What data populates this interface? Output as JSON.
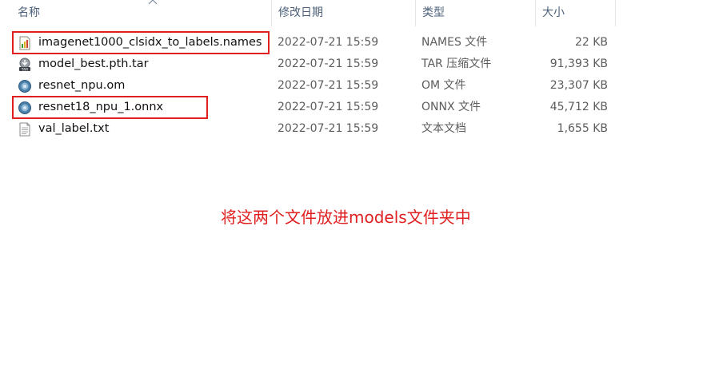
{
  "columns": {
    "name": "名称",
    "date": "修改日期",
    "type": "类型",
    "size": "大小"
  },
  "files": [
    {
      "name": "imagenet1000_clsidx_to_labels.names",
      "date": "2022-07-21 15:59",
      "type": "NAMES 文件",
      "size": "22 KB",
      "icon": "names-file-icon",
      "highlighted": true
    },
    {
      "name": "model_best.pth.tar",
      "date": "2022-07-21 15:59",
      "type": "TAR 压缩文件",
      "size": "91,393 KB",
      "icon": "tar-archive-icon",
      "highlighted": false
    },
    {
      "name": "resnet_npu.om",
      "date": "2022-07-21 15:59",
      "type": "OM 文件",
      "size": "23,307 KB",
      "icon": "model-file-icon",
      "highlighted": false
    },
    {
      "name": "resnet18_npu_1.onnx",
      "date": "2022-07-21 15:59",
      "type": "ONNX 文件",
      "size": "45,712 KB",
      "icon": "model-file-icon",
      "highlighted": true
    },
    {
      "name": "val_label.txt",
      "date": "2022-07-21 15:59",
      "type": "文本文档",
      "size": "1,655 KB",
      "icon": "text-file-icon",
      "highlighted": false
    }
  ],
  "annotation": "将这两个文件放进models文件夹中",
  "colors": {
    "highlight": "#e02020",
    "header_text": "#4c607a"
  }
}
